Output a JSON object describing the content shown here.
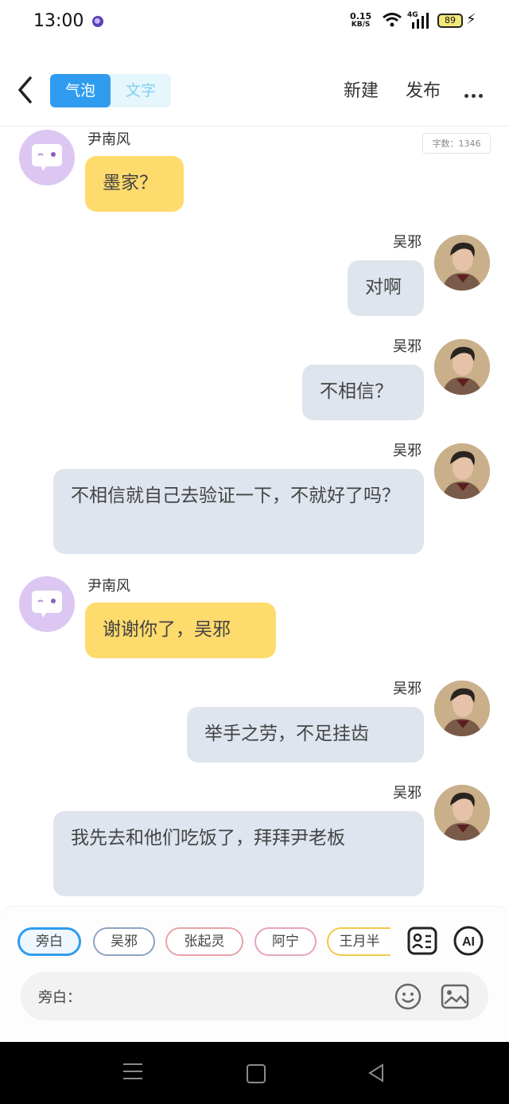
{
  "status": {
    "time": "13:00",
    "speed_value": "0.15",
    "speed_unit": "KB/S",
    "network": "4G",
    "battery": "89"
  },
  "header": {
    "tab_bubble": "气泡",
    "tab_text": "文字",
    "new_label": "新建",
    "publish_label": "发布"
  },
  "word_count": "字数：1346",
  "messages": [
    {
      "side": "left",
      "name": "尹南风",
      "text": "墨家？"
    },
    {
      "side": "right",
      "name": "吴邪",
      "text": "对啊"
    },
    {
      "side": "right",
      "name": "吴邪",
      "text": "不相信？"
    },
    {
      "side": "right",
      "name": "吴邪",
      "text": "不相信就自己去验证一下，不就好了吗？"
    },
    {
      "side": "left",
      "name": "尹南风",
      "text": "谢谢你了，吴邪"
    },
    {
      "side": "right",
      "name": "吴邪",
      "text": "举手之劳，不足挂齿"
    },
    {
      "side": "right",
      "name": "吴邪",
      "text": "我先去和他们吃饭了，拜拜尹老板"
    }
  ],
  "characters": [
    "旁白",
    "吴邪",
    "张起灵",
    "阿宁",
    "王月半"
  ],
  "input": {
    "label": "旁白："
  },
  "colors": {
    "accent": "#2f9cf0",
    "left_bubble": "#fedb6d",
    "right_bubble": "#dfe5ef"
  }
}
